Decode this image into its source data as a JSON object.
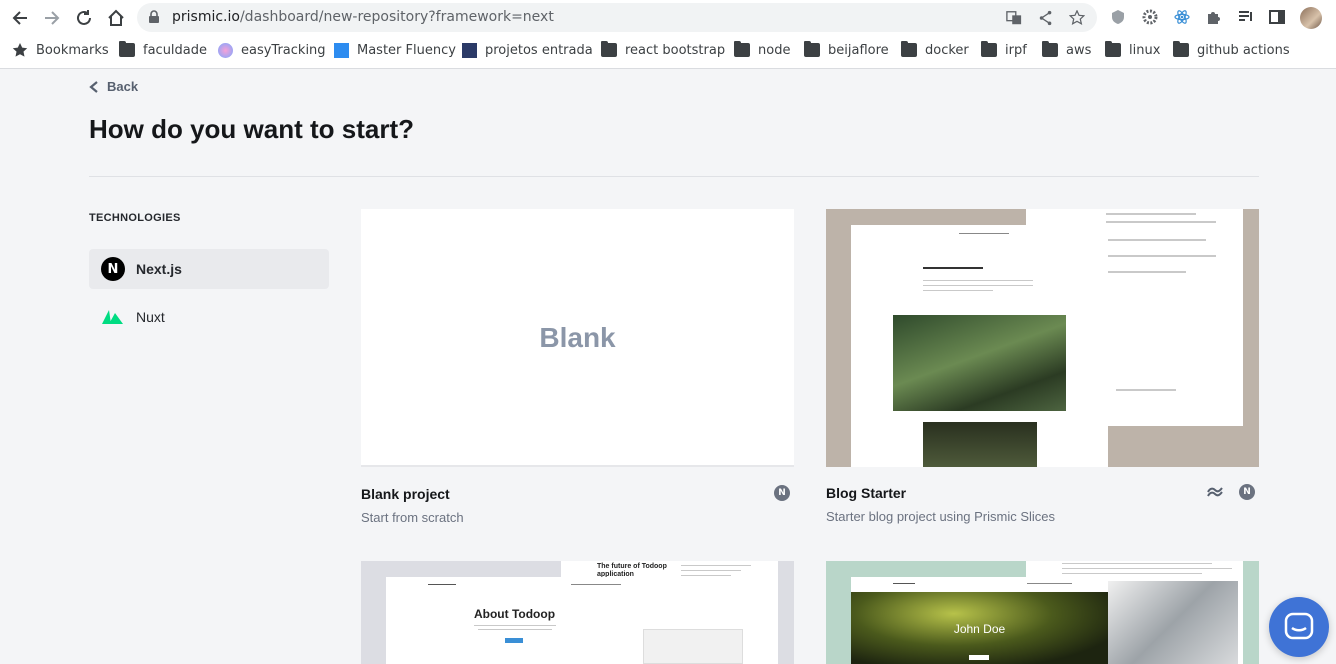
{
  "browser": {
    "url_host": "prismic.io",
    "url_path": "/dashboard/new-repository?framework=next",
    "bookmarks": [
      "Bookmarks",
      "faculdade",
      "easyTracking",
      "Master Fluency",
      "projetos entrada",
      "react bootstrap",
      "node",
      "beijaflore",
      "docker",
      "irpf",
      "aws",
      "linux",
      "github actions"
    ]
  },
  "page": {
    "back_label": "Back",
    "title": "How do you want to start?",
    "technologies_heading": "TECHNOLOGIES",
    "technologies": [
      {
        "label": "Next.js",
        "active": true
      },
      {
        "label": "Nuxt",
        "active": false
      }
    ]
  },
  "templates": [
    {
      "name": "Blank project",
      "description": "Start from scratch",
      "thumb_text": "Blank"
    },
    {
      "name": "Blog Starter",
      "description": "Starter blog project using Prismic Slices"
    },
    {
      "name": "",
      "description": "",
      "thumb_title": "About Todoop",
      "thumb_side_title": "The future of Todoop application"
    },
    {
      "name": "",
      "description": "",
      "thumb_title": "John Doe"
    }
  ],
  "badges": {
    "next": "N"
  },
  "colors": {
    "accent": "#3f73d6",
    "nuxt_green": "#00dc82",
    "blog_bg": "#bdb3a9",
    "portfolio_bg": "#b9d6c9"
  }
}
